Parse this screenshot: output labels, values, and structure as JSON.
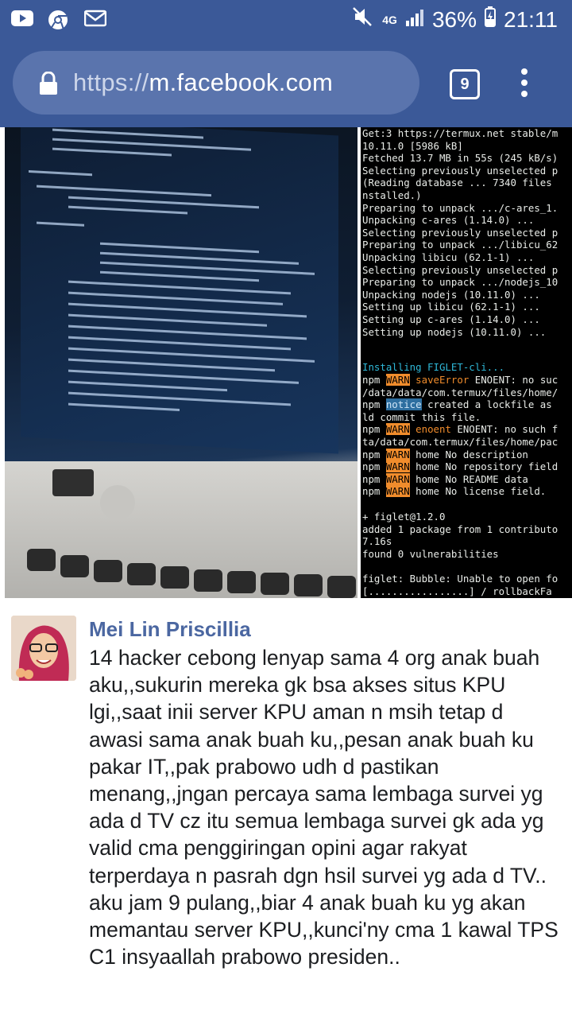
{
  "status_bar": {
    "network": "4G",
    "battery_percent": "36%",
    "time": "21:11",
    "left_icons": [
      "youtube-icon",
      "chrome-icon",
      "mail-icon"
    ],
    "right_icons": [
      "mute-icon",
      "signal-icon",
      "battery-icon"
    ]
  },
  "browser": {
    "url_scheme": "https://",
    "url_host": "m.facebook.com",
    "tab_count": "9"
  },
  "photo": {
    "terminal_lines": [
      "Get:3 https://termux.net stable/m",
      "10.11.0 [5986 kB]",
      "Fetched 13.7 MB in 55s (245 kB/s)",
      "Selecting previously unselected p",
      "(Reading database ... 7340 files",
      "nstalled.)",
      "Preparing to unpack .../c-ares_1.",
      "Unpacking c-ares (1.14.0) ...",
      "Selecting previously unselected p",
      "Preparing to unpack .../libicu_62",
      "Unpacking libicu (62.1-1) ...",
      "Selecting previously unselected p",
      "Preparing to unpack .../nodejs_10",
      "Unpacking nodejs (10.11.0) ...",
      "Setting up libicu (62.1-1) ...",
      "Setting up c-ares (1.14.0) ...",
      "Setting up nodejs (10.11.0) ..."
    ],
    "installing_line": "Installing FIGLET-cli...",
    "npm_lines": [
      {
        "tag": "WARN",
        "kind": "warn",
        "key": "saveError",
        "text": " ENOENT: no suc"
      },
      {
        "tag": "",
        "kind": "plain",
        "key": "",
        "text": "/data/data/com.termux/files/home/"
      },
      {
        "tag": "notice",
        "kind": "notice",
        "key": "",
        "text": " created a lockfile as"
      },
      {
        "tag": "",
        "kind": "plain",
        "key": "",
        "text": "ld commit this file."
      },
      {
        "tag": "WARN",
        "kind": "warn",
        "key": "enoent",
        "text": " ENOENT: no such f"
      },
      {
        "tag": "",
        "kind": "plain",
        "key": "",
        "text": "ta/data/com.termux/files/home/pac"
      },
      {
        "tag": "WARN",
        "kind": "warn",
        "key": "",
        "text": " home No description"
      },
      {
        "tag": "WARN",
        "kind": "warn",
        "key": "",
        "text": " home No repository field"
      },
      {
        "tag": "WARN",
        "kind": "warn",
        "key": "",
        "text": " home No README data"
      },
      {
        "tag": "WARN",
        "kind": "warn",
        "key": "",
        "text": " home No license field."
      }
    ],
    "tail_lines": [
      "+ figlet@1.2.0",
      "added 1 package from 1 contributo",
      "7.16s",
      "found 0 vulnerabilities",
      "",
      "figlet: Bubble: Unable to open fo",
      "[.................] / rollbackFa"
    ]
  },
  "comment": {
    "author": "Mei Lin Priscillia",
    "text": "14 hacker cebong lenyap sama 4 org anak buah aku,,sukurin mereka gk bsa akses situs KPU lgi,,saat inii server KPU aman n msih tetap d awasi sama anak buah ku,,pesan anak buah ku pakar IT,,pak prabowo udh d pastikan menang,,jngan percaya sama lembaga survei yg ada d TV cz itu semua lembaga survei gk ada yg valid cma penggiringan opini agar rakyat terperdaya n pasrah dgn hsil survei yg ada d TV..\naku jam 9 pulang,,biar 4 anak buah ku yg akan memantau server KPU,,kunci'ny cma 1 kawal TPS C1 insyaallah prabowo presiden.."
  },
  "colors": {
    "facebook_blue": "#3b5998",
    "url_box": "#5a74ad",
    "author_name": "#4b67a1",
    "npm_warn": "#f08c2c",
    "npm_notice": "#2e6fa0"
  }
}
